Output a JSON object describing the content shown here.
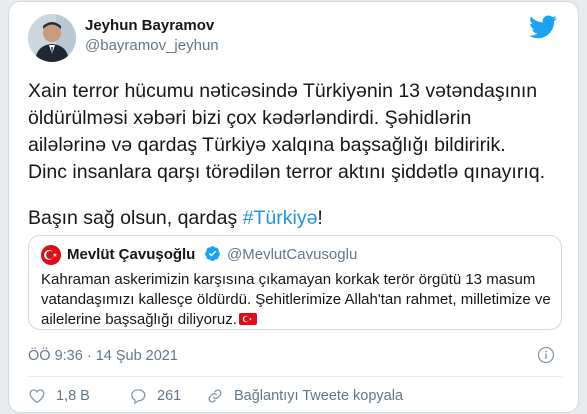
{
  "author": {
    "name": "Jeyhun Bayramov",
    "handle": "@bayramov_jeyhun"
  },
  "tweet": {
    "paragraph": "Xain terror hücumu nəticəsində Türkiyənin 13 vətəndaşının\nöldürülməsi xəbəri bizi çox kədərləndirdi. Şəhidlərin\nailələrinə və qardaş Türkiyə xalqına başsağlığı  bildiririk.\nDinc insanlara qarşı törədilən terror aktını şiddətlə qınayırıq.",
    "closing_prefix": "Başın sağ olsun, qardaş ",
    "hashtag": "#Türkiyə",
    "closing_suffix": "!"
  },
  "quoted": {
    "name": "Mevlüt Çavuşoğlu",
    "handle": "@MevlutCavusoglu",
    "text": "Kahraman askerimizin karşısına çıkamayan korkak terör örgütü 13 masum vatandaşımızı kallesçe öldürdü. Şehitlerimize Allah'tan rahmet, milletimize ve ailelerine başsağlığı diliyoruz."
  },
  "timestamp": "ÖÖ 9:36 · 14 Şub 2021",
  "actions": {
    "likes": "1,8 B",
    "replies": "261",
    "copy_link": "Bağlantıyı Tweete kopyala"
  },
  "colors": {
    "brand": "#1da1f2",
    "hashtag": "#1b95e0",
    "like_icon": "#8899a6",
    "text_secondary": "#657786",
    "turkish_flag": "#e30a17"
  },
  "icons": {
    "brand": "twitter-bird-icon",
    "verified": "verified-badge-icon",
    "info": "info-icon",
    "like": "heart-icon",
    "reply": "reply-bubble-icon",
    "copy_link": "link-icon"
  }
}
